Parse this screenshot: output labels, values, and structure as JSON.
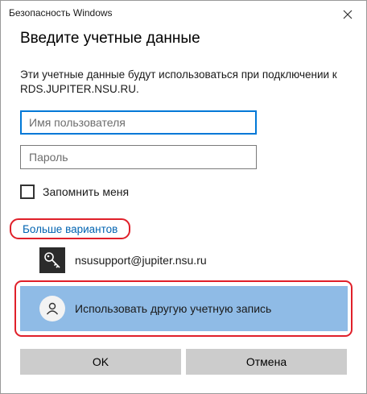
{
  "window": {
    "title": "Безопасность Windows"
  },
  "dialog": {
    "heading": "Введите учетные данные",
    "description": "Эти учетные данные будут использоваться при подключении к RDS.JUPITER.NSU.RU."
  },
  "form": {
    "username_placeholder": "Имя пользователя",
    "username_value": "",
    "password_placeholder": "Пароль",
    "password_value": "",
    "remember_label": "Запомнить меня",
    "remember_checked": false
  },
  "options": {
    "more_label": "Больше вариантов",
    "account": "nsusupport@jupiter.nsu.ru",
    "other_account": "Использовать другую учетную запись"
  },
  "buttons": {
    "ok": "OK",
    "cancel": "Отмена"
  },
  "colors": {
    "accent": "#0078d7",
    "link": "#0063b1",
    "selected_option": "#8fbbe6",
    "highlight_outline": "#e0202a"
  }
}
